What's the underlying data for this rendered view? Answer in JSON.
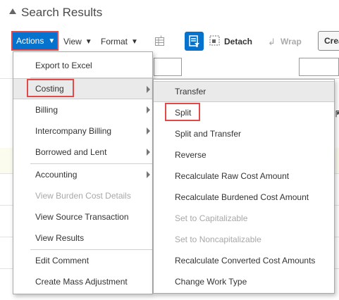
{
  "header": {
    "title": "Search Results"
  },
  "toolbar": {
    "actions_label": "Actions",
    "view_label": "View",
    "format_label": "Format",
    "detach_label": "Detach",
    "wrap_label": "Wrap",
    "create_label": "Crea"
  },
  "actions_menu": {
    "items": [
      {
        "label": "Export to Excel"
      },
      {
        "label": "Costing"
      },
      {
        "label": "Billing"
      },
      {
        "label": "Intercompany Billing"
      },
      {
        "label": "Borrowed and Lent"
      },
      {
        "label": "Accounting"
      },
      {
        "label": "View Burden Cost Details"
      },
      {
        "label": "View Source Transaction"
      },
      {
        "label": "View Results"
      },
      {
        "label": "Edit Comment"
      },
      {
        "label": "Create Mass Adjustment"
      }
    ]
  },
  "costing_submenu": {
    "items": [
      {
        "label": "Transfer"
      },
      {
        "label": "Split"
      },
      {
        "label": "Split and Transfer"
      },
      {
        "label": "Reverse"
      },
      {
        "label": "Recalculate Raw Cost Amount"
      },
      {
        "label": "Recalculate Burdened Cost Amount"
      },
      {
        "label": "Set to Capitalizable"
      },
      {
        "label": "Set to Noncapitalizable"
      },
      {
        "label": "Recalculate Converted Cost Amounts"
      },
      {
        "label": "Change Work Type"
      }
    ]
  },
  "colors": {
    "accent": "#0572ce",
    "highlight_box": "#e24a4a"
  }
}
